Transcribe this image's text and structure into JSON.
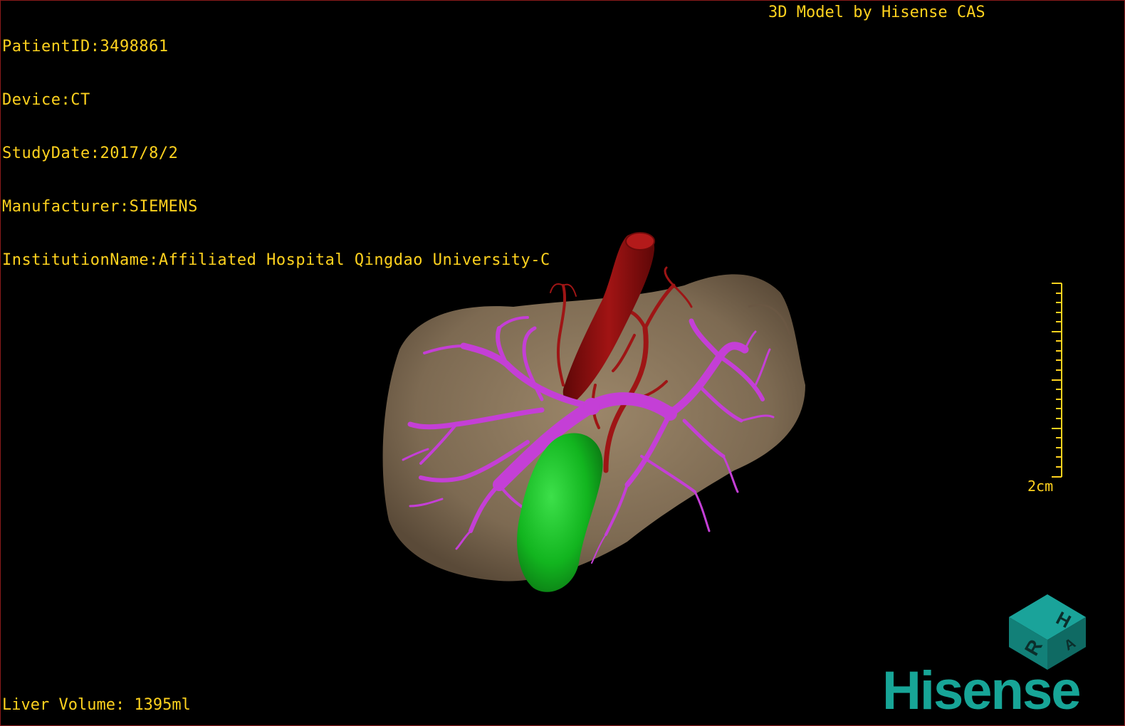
{
  "window": {
    "title": "3D Model by Hisense CAS"
  },
  "study_info": {
    "patient_id": "PatientID:3498861",
    "device": "Device:CT",
    "study_date": "StudyDate:2017/8/2",
    "manufacturer": "Manufacturer:SIEMENS",
    "institution": "InstitutionName:Affiliated Hospital Qingdao University-C"
  },
  "measurements": {
    "liver_volume": "Liver Volume: 1395ml"
  },
  "scale_bar": {
    "label": "2cm"
  },
  "orientation_cube": {
    "face_top": "H",
    "face_front": "R",
    "face_side": "A"
  },
  "brand": {
    "logo_text": "Hisense"
  },
  "colors": {
    "overlay_text": "#ffd21e",
    "liver": "#8e7a61",
    "portal_vein": "#c43fd6",
    "artery": "#8e0e0e",
    "gallbladder": "#12b51f",
    "brand": "#17a597"
  }
}
